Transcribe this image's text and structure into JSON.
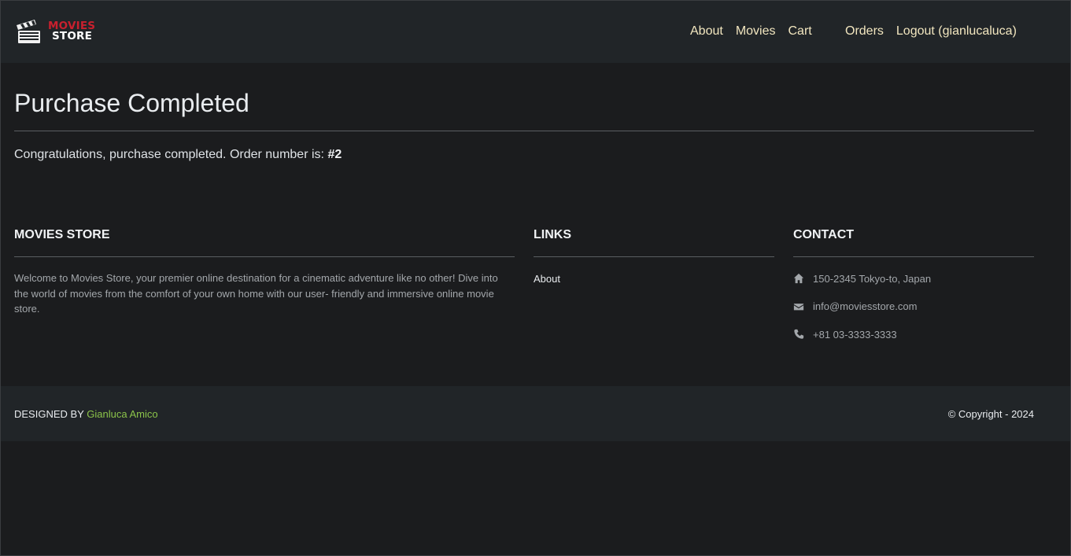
{
  "brand": {
    "line1": "MOVIES",
    "line2": "STORE",
    "accent_color": "#c8202e"
  },
  "nav": {
    "left": [
      {
        "label": "About"
      },
      {
        "label": "Movies"
      },
      {
        "label": "Cart"
      }
    ],
    "right": [
      {
        "label": "Orders"
      },
      {
        "label": "Logout (gianlucaluca)"
      }
    ],
    "link_color": "#f2e6bf"
  },
  "main": {
    "title": "Purchase Completed",
    "message": "Congratulations, purchase completed. Order number is:",
    "order_number": "#2"
  },
  "footer": {
    "about": {
      "heading": "MOVIES STORE",
      "text": "Welcome to Movies Store, your premier online destination for a cinematic adventure like no other! Dive into the world of movies from the comfort of your own home with our user- friendly and immersive online movie store."
    },
    "links": {
      "heading": "LINKS",
      "items": [
        {
          "label": "About"
        }
      ]
    },
    "contact": {
      "heading": "CONTACT",
      "address": {
        "icon": "home-icon",
        "text": "150-2345 Tokyo-to, Japan"
      },
      "email": {
        "icon": "envelope-icon",
        "text": "info@moviesstore.com"
      },
      "phone": {
        "icon": "phone-icon",
        "text": "+81 03-3333-3333"
      }
    }
  },
  "bottom": {
    "designed_prefix": "DESIGNED BY",
    "designer": "Gianluca Amico",
    "designer_color": "#8bc34a",
    "copyright": "© Copyright - 2024"
  }
}
